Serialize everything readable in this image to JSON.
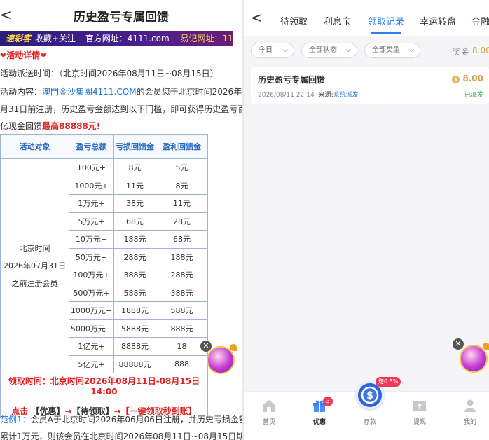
{
  "left": {
    "back_label": "<",
    "title": "历史盈亏专属回馈",
    "banner": {
      "logo": "速彩客",
      "slogan": "收藏+关注",
      "site_label": "官方网址：4111.com",
      "alt_label": "易记网址：111.tc"
    },
    "detail_heading": "活动详情",
    "dispatch_time": "活动派送时间：（北京时间2026年08月11日~08月15日）",
    "content_prefix": "活动内容：",
    "content_brand": "澳門金沙集團4111.COM",
    "content_mid": "的会员您于北京时间2026年07",
    "content_line2": "月31日前注册，历史盈亏金额达到以下门槛，即可获得历史盈亏百",
    "content_line3_prefix": "亿现金回馈",
    "content_line3_highlight": "最高88888元!",
    "table": {
      "headers": [
        "活动对象",
        "盈亏总额",
        "亏损回馈金",
        "盈利回馈金"
      ],
      "target_lines": [
        "北京时间",
        "2026年07月31日",
        "之前注册会员"
      ],
      "rows": [
        [
          "100元+",
          "8元",
          "5元"
        ],
        [
          "1000元+",
          "11元",
          "8元"
        ],
        [
          "1万元+",
          "38元",
          "11元"
        ],
        [
          "5万元+",
          "68元",
          "28元"
        ],
        [
          "10万元+",
          "188元",
          "68元"
        ],
        [
          "50万元+",
          "288元",
          "188元"
        ],
        [
          "100万元+",
          "388元",
          "288元"
        ],
        [
          "500万元+",
          "588元",
          "388元"
        ],
        [
          "1000万元+",
          "1888元",
          "588元"
        ],
        [
          "5000万元+",
          "5888元",
          "888元"
        ],
        [
          "1亿元+",
          "8888元",
          "18"
        ],
        [
          "5亿元+",
          "88888元",
          "888"
        ]
      ],
      "footer_time": "领取时间：北京时间2026年08月11日-08月15日14:00",
      "footer_steps": {
        "click": "点击",
        "step1": "【优惠】",
        "arrow1": "→",
        "step2": "【待领取】",
        "arrow2": "→",
        "step3": "【一键领取秒到账】"
      }
    },
    "example_label": "范例1：",
    "example_text": "会员A于北京时间2026年06月06日注册，并历史亏损金额",
    "example_text2": "累计1万元，则该会员在北京时间2026年08月11日~08月15日期间"
  },
  "right": {
    "back_label": "<",
    "tabs": [
      "待领取",
      "利息宝",
      "领取记录",
      "幸运转盘",
      "金融"
    ],
    "active_tab": 2,
    "filters": [
      "今日",
      "全部状态",
      "全部类型"
    ],
    "bonus_label": "奖金",
    "bonus_value": "8.00",
    "record": {
      "title": "历史盈亏专属回馈",
      "amount": "8.00",
      "time": "2026/08/11 22:14",
      "source_label": "来源:",
      "source_value": "系统派发",
      "status": "已派发"
    },
    "nav": [
      {
        "label": "首页"
      },
      {
        "label": "优惠",
        "badge": "3"
      },
      {
        "label": "存款"
      },
      {
        "label": "提现"
      },
      {
        "label": "我的"
      }
    ],
    "deposit_badge": "送0.5%"
  },
  "colors": {
    "accent_blue": "#2e7dea",
    "gold": "#d7a34a",
    "red": "#e02020",
    "green": "#2bb24c"
  }
}
